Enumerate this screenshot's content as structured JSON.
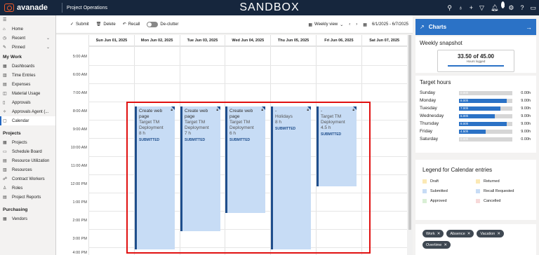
{
  "header": {
    "logo_text": "avanade",
    "app_name": "Project Operations",
    "environment": "SANDBOX",
    "notification_count": "1"
  },
  "sidebar": {
    "items_top": [
      {
        "label": "Home",
        "icon": "home-icon"
      },
      {
        "label": "Recent",
        "icon": "clock-icon"
      },
      {
        "label": "Pinned",
        "icon": "pin-icon"
      }
    ],
    "section_mywork": "My Work",
    "mywork": [
      {
        "label": "Dashboards"
      },
      {
        "label": "Time Entries"
      },
      {
        "label": "Expenses"
      },
      {
        "label": "Material Usage"
      },
      {
        "label": "Approvals"
      },
      {
        "label": "Approvals Agent (..."
      },
      {
        "label": "Calendar"
      }
    ],
    "section_projects": "Projects",
    "projects": [
      {
        "label": "Projects"
      },
      {
        "label": "Schedule Board"
      },
      {
        "label": "Resource Utilization"
      },
      {
        "label": "Resources"
      },
      {
        "label": "Contract Workers"
      },
      {
        "label": "Roles"
      },
      {
        "label": "Project Reports"
      }
    ],
    "section_purchasing": "Purchasing",
    "purchasing": [
      {
        "label": "Vendors"
      }
    ]
  },
  "toolbar": {
    "submit": "Submit",
    "delete": "Delete",
    "recall": "Recall",
    "declutter": "De-clutter",
    "view": "Weekly view",
    "date_range": "6/1/2025 - 6/7/2025"
  },
  "calendar": {
    "days": [
      "Sun Jun 01, 2025",
      "Mon Jun 02, 2025",
      "Tue Jun 03, 2025",
      "Wed Jun 04, 2025",
      "Thu Jun 05, 2025",
      "Fri Jun 06, 2025",
      "Sat Jun 07, 2025"
    ],
    "times": [
      "5:00 AM",
      "6:00 AM",
      "7:00 AM",
      "8:00 AM",
      "9:00 AM",
      "10:00 AM",
      "11:00 AM",
      "12:00 PM",
      "1:00 PM",
      "2:00 PM",
      "3:00 PM",
      "4:00 PM"
    ],
    "events": [
      {
        "title": "Create web page",
        "type": "Target TM Deployment",
        "hours": "8 h",
        "status": "SUBMITTED"
      },
      {
        "title": "Create web page",
        "type": "Target TM Deployment",
        "hours": "7 h",
        "status": "SUBMITTED"
      },
      {
        "title": "Create web page",
        "type": "Target TM Deployment",
        "hours": "6 h",
        "status": "SUBMITTED"
      },
      {
        "title": "-",
        "type": "Holidays",
        "hours": "8 h",
        "status": "SUBMITTED"
      },
      {
        "title": "-",
        "type": "Target TM Deployment",
        "hours": "4.5 h",
        "status": "SUBMITTED"
      }
    ]
  },
  "charts_panel": {
    "title": "Charts",
    "weekly_snapshot": {
      "title": "Weekly snapshot",
      "value": "33.50 of 45.00",
      "label": "Hours logged",
      "progress": 0.744
    },
    "target_hours": {
      "title": "Target hours",
      "rows": [
        {
          "day": "Sunday",
          "logged": "0.00h",
          "target": "0.00h",
          "fraction": 0
        },
        {
          "day": "Monday",
          "logged": "8.00h",
          "target": "9.00h",
          "fraction": 0.889
        },
        {
          "day": "Tuesday",
          "logged": "7.00h",
          "target": "9.00h",
          "fraction": 0.778
        },
        {
          "day": "Wednesday",
          "logged": "6.00h",
          "target": "9.00h",
          "fraction": 0.667
        },
        {
          "day": "Thursday",
          "logged": "8.00h",
          "target": "9.00h",
          "fraction": 0.889
        },
        {
          "day": "Friday",
          "logged": "4.50h",
          "target": "9.00h",
          "fraction": 0.5
        },
        {
          "day": "Saturday",
          "logged": "0.00h",
          "target": "0.00h",
          "fraction": 0
        }
      ]
    },
    "legend": {
      "title": "Legend for Calendar entries",
      "items": [
        {
          "label": "Draft",
          "color": "#fbe9b5"
        },
        {
          "label": "Returned",
          "color": "#fbe9b5"
        },
        {
          "label": "Submitted",
          "color": "#c7dcf5"
        },
        {
          "label": "Recall Requested",
          "color": "#c7dcf5"
        },
        {
          "label": "Approved",
          "color": "#d9efd5"
        },
        {
          "label": "Cancelled",
          "color": "#f7d9d9"
        }
      ]
    },
    "filters": [
      "Work",
      "Absence",
      "Vacation",
      "Overtime"
    ]
  }
}
